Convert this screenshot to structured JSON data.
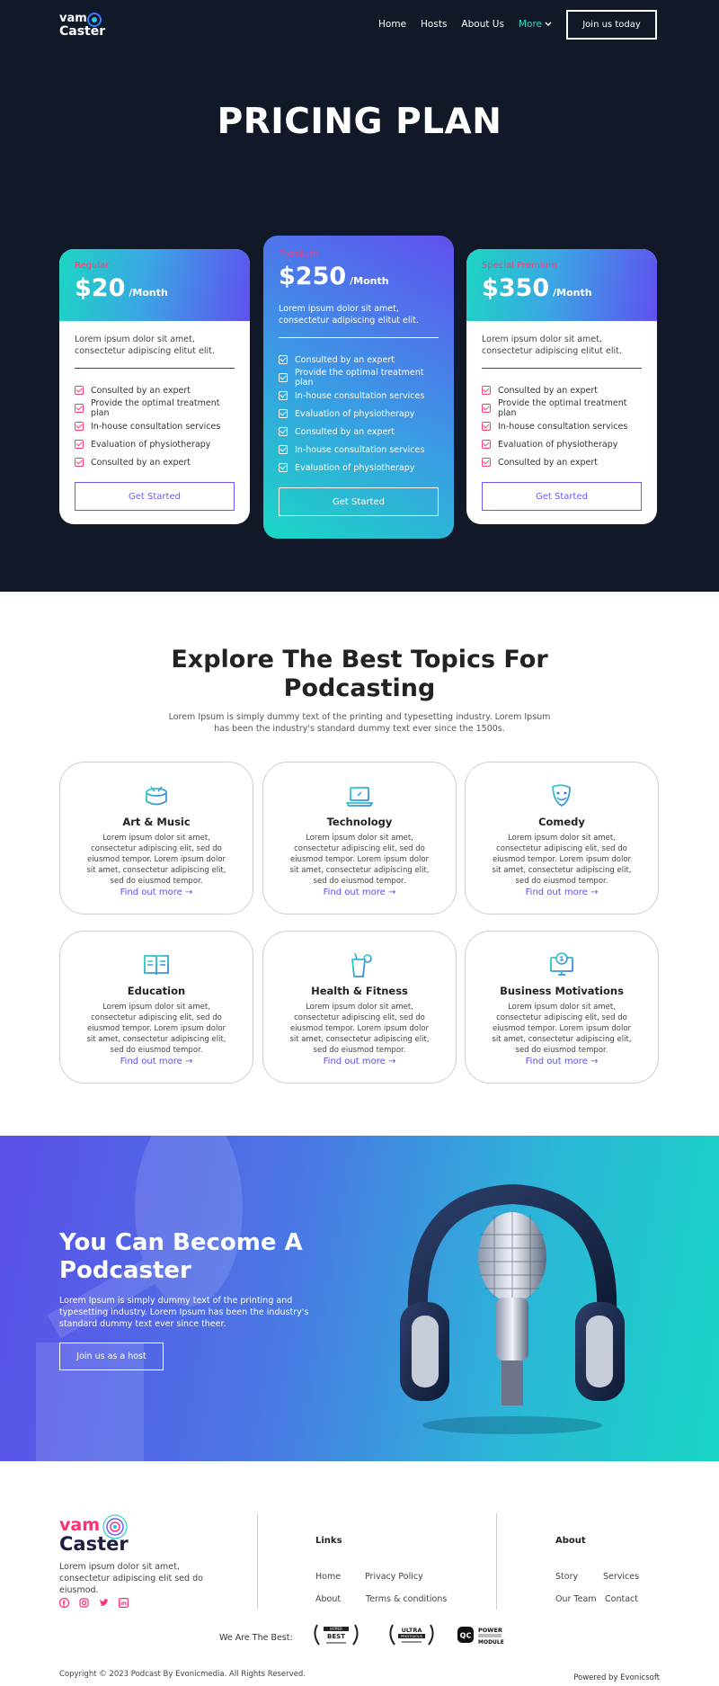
{
  "nav": {
    "logo_line1": "vam",
    "logo_line2": "Caster",
    "items": [
      "Home",
      "Hosts",
      "About Us"
    ],
    "more": "More",
    "join": "Join us today"
  },
  "pricing": {
    "title": "PRICING PLAN",
    "plans": [
      {
        "tier": "Regular",
        "price": "$20",
        "period": "/Month",
        "desc": "Lorem ipsum dolor sit amet, consectetur adipiscing elitut elit.",
        "features": [
          "Consulted by an expert",
          "Provide the optimal treatment plan",
          "In-house consultation services",
          "Evaluation of physiotherapy",
          "Consulted by an expert"
        ],
        "cta": "Get Started"
      },
      {
        "tier": "Premium",
        "price": "$250",
        "period": "/Month",
        "desc": "Lorem ipsum dolor sit amet, consectetur adipiscing elitut elit.",
        "features": [
          "Consulted by an expert",
          "Provide the optimal treatment plan",
          "In-house consultation services",
          "Evaluation of physiotherapy",
          "Consulted by an expert",
          "In-house consultation services",
          "Evaluation of physiotherapy"
        ],
        "cta": "Get Started"
      },
      {
        "tier": "Special Premium",
        "price": "$350",
        "period": "/Month",
        "desc": "Lorem ipsum dolor sit amet, consectetur adipiscing elitut elit.",
        "features": [
          "Consulted by an expert",
          "Provide the optimal treatment plan",
          "In-house consultation services",
          "Evaluation of physiotherapy",
          "Consulted by an expert"
        ],
        "cta": "Get Started"
      }
    ]
  },
  "topics": {
    "title_line1": "Explore The Best Topics For",
    "title_line2": "Podcasting",
    "subtitle": "Lorem Ipsum is simply dummy text of the printing and typesetting industry. Lorem Ipsum has been the industry's standard dummy text ever since the 1500s.",
    "items": [
      {
        "name": "Art & Music",
        "icon": "drum-icon",
        "desc": "Lorem ipsum dolor sit amet, consectetur adipiscing elit, sed do eiusmod tempor. Lorem ipsum dolor sit amet, consectetur adipiscing elit, sed do eiusmod tempor.",
        "link": "Find out more"
      },
      {
        "name": "Technology",
        "icon": "laptop-icon",
        "desc": "Lorem ipsum dolor sit amet, consectetur adipiscing elit, sed do eiusmod tempor. Lorem ipsum dolor sit amet, consectetur adipiscing elit, sed do eiusmod tempor.",
        "link": "Find out more"
      },
      {
        "name": "Comedy",
        "icon": "comedy-mask-icon",
        "desc": "Lorem ipsum dolor sit amet, consectetur adipiscing elit, sed do eiusmod tempor. Lorem ipsum dolor sit amet, consectetur adipiscing elit, sed do eiusmod tempor.",
        "link": "Find out more"
      },
      {
        "name": "Education",
        "icon": "book-icon",
        "desc": "Lorem ipsum dolor sit amet, consectetur adipiscing elit, sed do eiusmod tempor. Lorem ipsum dolor sit amet, consectetur adipiscing elit, sed do eiusmod tempor.",
        "link": "Find out more"
      },
      {
        "name": "Health & Fitness",
        "icon": "juice-glass-icon",
        "desc": "Lorem ipsum dolor sit amet, consectetur adipiscing elit, sed do eiusmod tempor. Lorem ipsum dolor sit amet, consectetur adipiscing elit, sed do eiusmod tempor.",
        "link": "Find out more"
      },
      {
        "name": "Business Motivations",
        "icon": "money-monitor-icon",
        "desc": "Lorem ipsum dolor sit amet, consectetur adipiscing elit, sed do eiusmod tempor. Lorem ipsum dolor sit amet, consectetur adipiscing elit, sed do eiusmod tempor.",
        "link": "Find out more"
      }
    ]
  },
  "banner": {
    "title_line1": "You Can Become A",
    "title_line2": "Podcaster",
    "text": "Lorem Ipsum is simply dummy text of the printing and typesetting industry. Lorem Ipsum has been the industry's standard dummy text ever since theer.",
    "cta": "Join us as a host"
  },
  "footer": {
    "logo_line1": "vam",
    "logo_line2": "Caster",
    "text": "Lorem ipsum dolor sit amet, consectetur adipiscing elit  sed do eiusmod.",
    "links_title": "Links",
    "links": [
      "Home",
      "Privacy Policy",
      "About",
      "Terms & conditions"
    ],
    "about_title": "About",
    "about": [
      "Story",
      "Services",
      "Our Team",
      "Contact"
    ],
    "best_label": "We Are The Best:",
    "awards": [
      {
        "top": "HYPER",
        "main": "BEST"
      },
      {
        "top": "ULTRA",
        "main": "PRESTIGIOUS"
      },
      {
        "top": "POWER",
        "main": "MODULE"
      }
    ],
    "copyright": "Copyright © 2023 Podcast By Evonicmedia. All Rights Reserved.",
    "powered": "Powered by Evonicsoft"
  },
  "colors": {
    "dark_bg": "#111827",
    "accent_pink": "#ff3c6e",
    "accent_purple": "#5b4ff0",
    "accent_teal": "#1dd6c3"
  }
}
